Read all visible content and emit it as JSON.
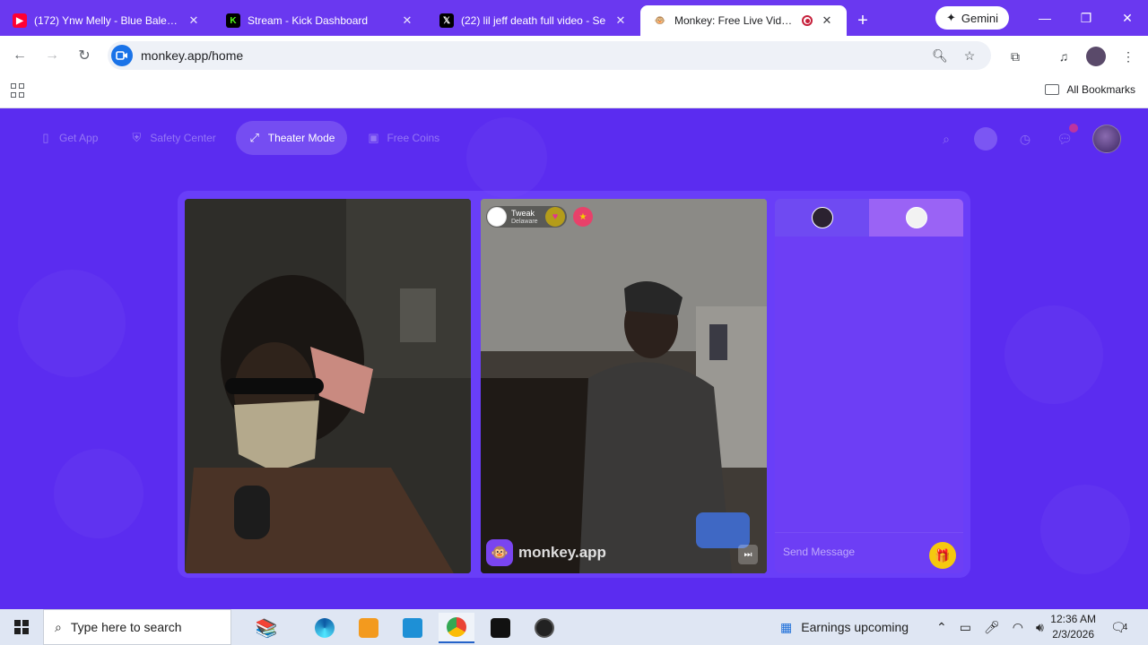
{
  "tabs": [
    {
      "title": "(172) Ynw Melly - Blue Balenciaga",
      "favicon": "youtube-icon"
    },
    {
      "title": "Stream - Kick Dashboard",
      "favicon": "kick-icon"
    },
    {
      "title": "(22) lil jeff death full video - Se",
      "favicon": "x-icon"
    },
    {
      "title": "Monkey: Free Live Video Ch",
      "favicon": "monkey-icon",
      "active": true
    }
  ],
  "gemini_label": "Gemini",
  "url": "monkey.app/home",
  "bookmarks": {
    "all_label": "All Bookmarks"
  },
  "site_nav": {
    "items": [
      {
        "label": "Get App",
        "icon": "phone-icon"
      },
      {
        "label": "Safety Center",
        "icon": "shield-icon"
      },
      {
        "label": "Theater Mode",
        "icon": "expand-icon"
      },
      {
        "label": "Free Coins",
        "icon": "coins-icon"
      }
    ]
  },
  "remote_user": {
    "name": "Tweak",
    "location": "Delaware"
  },
  "watermark": "monkey.app",
  "chat": {
    "placeholder": "Send Message"
  },
  "taskbar": {
    "search_placeholder": "Type here to search",
    "news": "Earnings upcoming",
    "time": "12:36 AM",
    "date": "2/3/2026",
    "notifications": "4"
  },
  "colors": {
    "page_bg": "#5b2cf0",
    "accent": "#6a38f0",
    "gift": "#f5c80f"
  }
}
